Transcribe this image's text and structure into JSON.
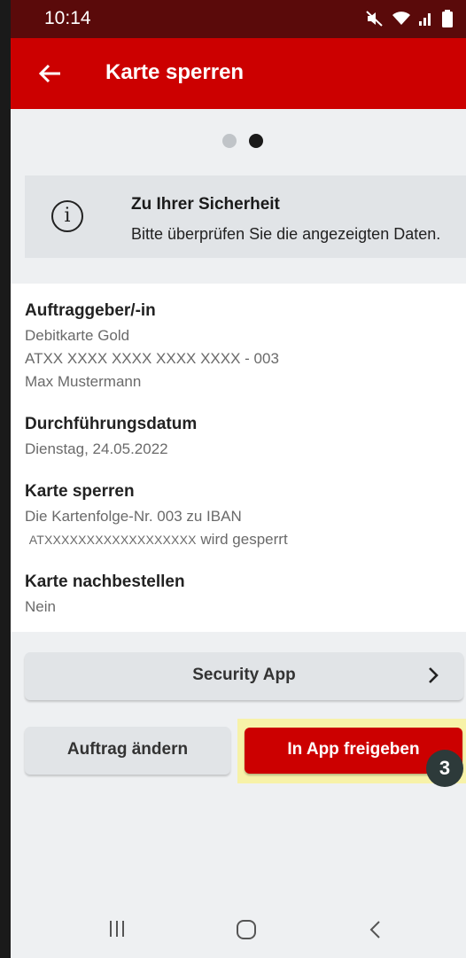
{
  "status_bar": {
    "time": "10:14",
    "icons": [
      "mute-icon",
      "wifi-icon",
      "signal-icon",
      "battery-icon"
    ]
  },
  "app_bar": {
    "title": "Karte sperren",
    "back_icon": "arrow-left-icon",
    "color": "#cc0000"
  },
  "stepper": {
    "total": 2,
    "active": 2
  },
  "info_box": {
    "icon": "info-icon",
    "heading": "Zu Ihrer Sicherheit",
    "text": "Bitte überprüfen Sie die angezeigten Daten."
  },
  "details": {
    "orderer": {
      "label": "Auftraggeber/-in",
      "card": "Debitkarte Gold",
      "account": "ATXX XXXX XXXX XXXX XXXX - 003",
      "name": "Max Mustermann"
    },
    "execution_date": {
      "label": "Durchführungsdatum",
      "value": "Dienstag, 24.05.2022"
    },
    "block_card": {
      "label": "Karte sperren",
      "line1": "Die Kartenfolge-Nr. 003 zu IBAN",
      "iban": "ATXXXXXXXXXXXXXXXXXX",
      "suffix": "wird gesperrt"
    },
    "reorder_card": {
      "label": "Karte nachbestellen",
      "value": "Nein"
    }
  },
  "security_app": {
    "label": "Security App",
    "chevron_icon": "chevron-right-icon"
  },
  "actions": {
    "change_label": "Auftrag ändern",
    "release_label": "In App freigeben"
  },
  "annotation": {
    "step": "3",
    "highlight_color": "#f7f2a8"
  },
  "nav_bar": {
    "icons": [
      "recent-apps-icon",
      "home-icon",
      "back-icon"
    ]
  }
}
